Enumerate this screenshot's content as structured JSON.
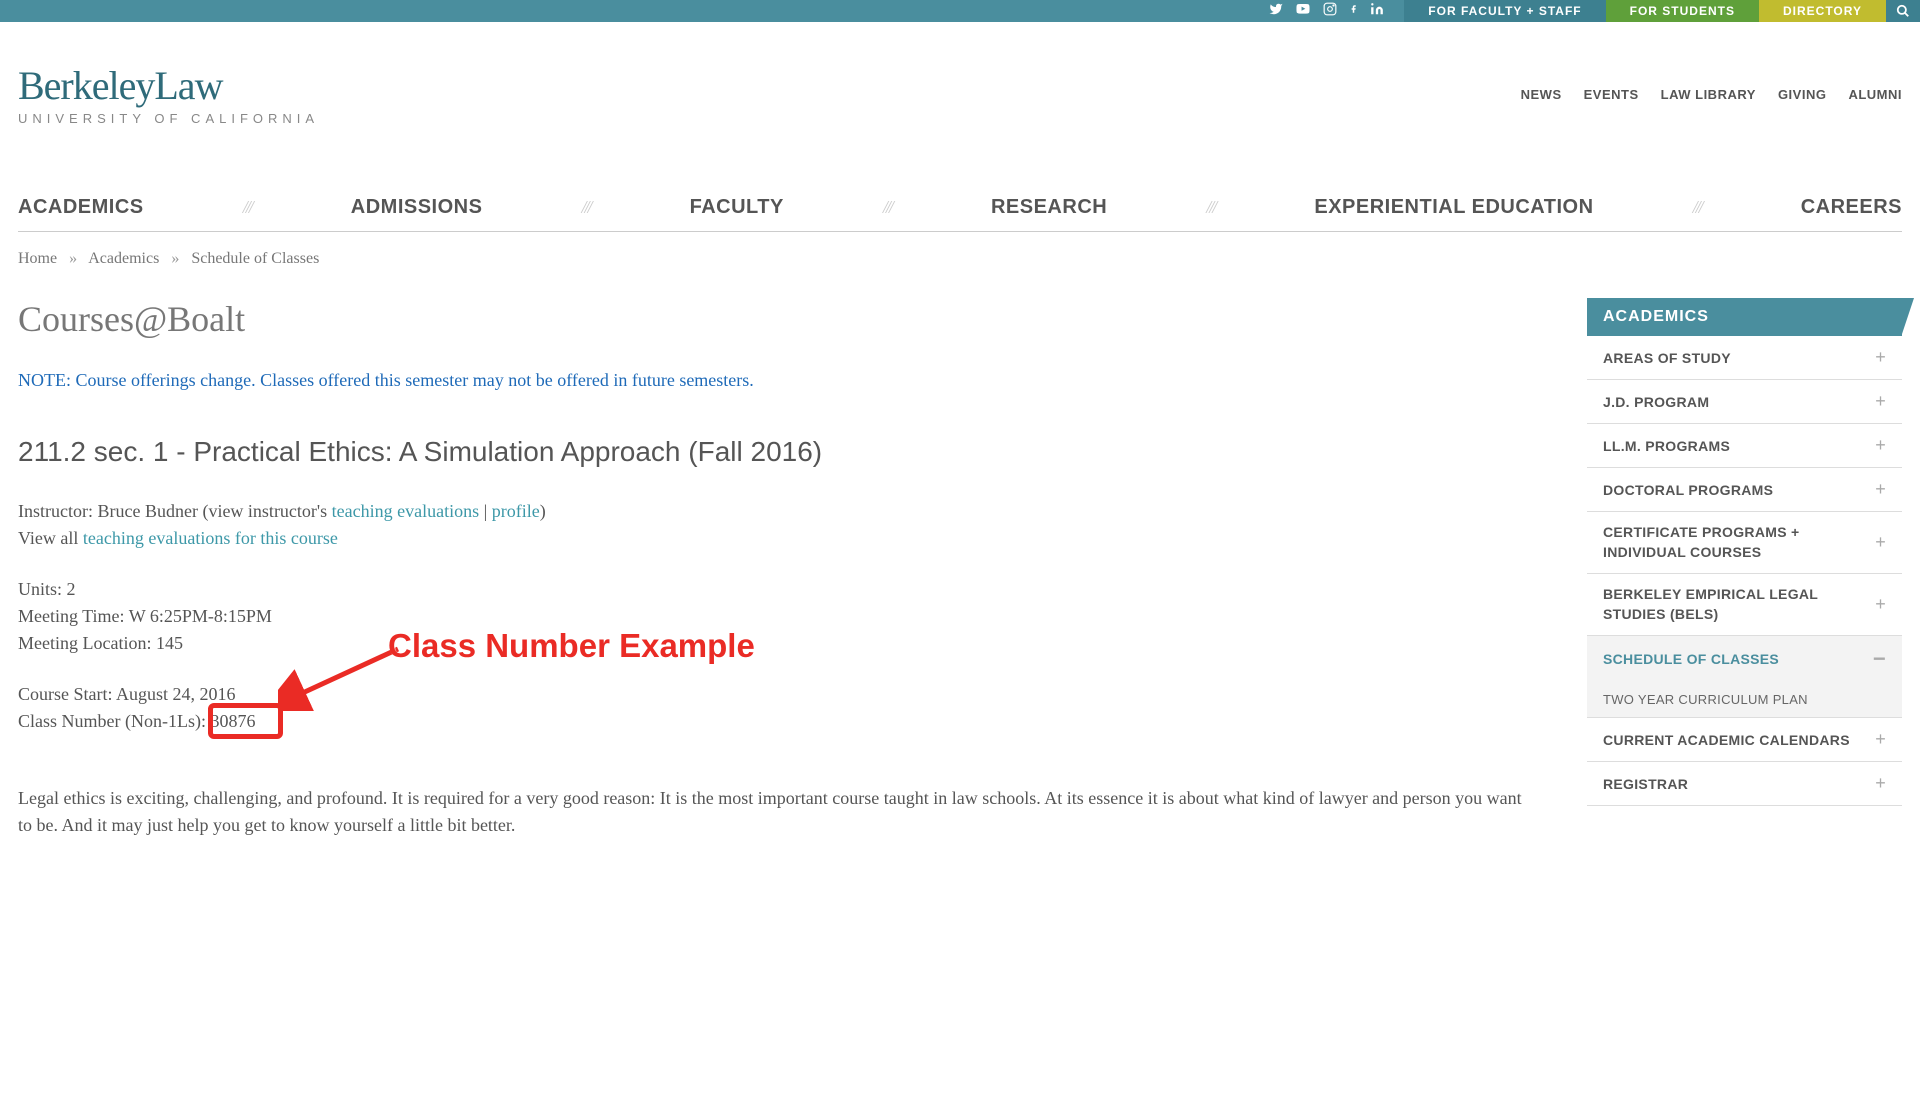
{
  "topbar": {
    "faculty_staff": "FOR FACULTY + STAFF",
    "students": "FOR STUDENTS",
    "directory": "DIRECTORY"
  },
  "logo": {
    "main": "BerkeleyLaw",
    "sub": "UNIVERSITY OF CALIFORNIA"
  },
  "topnav": [
    "NEWS",
    "EVENTS",
    "LAW LIBRARY",
    "GIVING",
    "ALUMNI"
  ],
  "mainnav": [
    "ACADEMICS",
    "ADMISSIONS",
    "FACULTY",
    "RESEARCH",
    "EXPERIENTIAL EDUCATION",
    "CAREERS"
  ],
  "breadcrumb": {
    "home": "Home",
    "academics": "Academics",
    "schedule": "Schedule of Classes"
  },
  "page": {
    "title": "Courses@Boalt",
    "note": "NOTE: Course offerings change. Classes offered this semester may not be offered in future semesters.",
    "course_title": "211.2 sec. 1 - Practical Ethics: A Simulation Approach (Fall 2016)",
    "instructor_prefix": "Instructor: Bruce Budner  (view instructor's ",
    "teaching_eval": "teaching evaluations",
    "pipe": " | ",
    "profile": "profile",
    "close_paren": ")",
    "view_all": "View all ",
    "course_evals": "teaching evaluations for this course",
    "units": "Units: 2",
    "meeting_time": "Meeting Time: W 6:25PM-8:15PM",
    "meeting_loc": "Meeting Location: 145",
    "course_start": "Course Start: August 24, 2016",
    "class_num_prefix": "Class Number (Non-1Ls): ",
    "class_num": "30876",
    "body": "Legal ethics is exciting, challenging, and profound. It is required for a very good reason: It is the most important course taught in law schools. At its essence it is about what kind of lawyer and person you want to be. And it may just help you get to know yourself a little bit better."
  },
  "annotation": {
    "label": "Class Number Example"
  },
  "sidebar": {
    "header": "ACADEMICS",
    "items": [
      "AREAS OF STUDY",
      "J.D. PROGRAM",
      "LL.M. PROGRAMS",
      "DOCTORAL PROGRAMS",
      "CERTIFICATE PROGRAMS + INDIVIDUAL COURSES",
      "BERKELEY EMPIRICAL LEGAL STUDIES (BELS)"
    ],
    "active": "SCHEDULE OF CLASSES",
    "sub": "TWO YEAR CURRICULUM PLAN",
    "items2": [
      "CURRENT ACADEMIC CALENDARS",
      "REGISTRAR"
    ]
  }
}
